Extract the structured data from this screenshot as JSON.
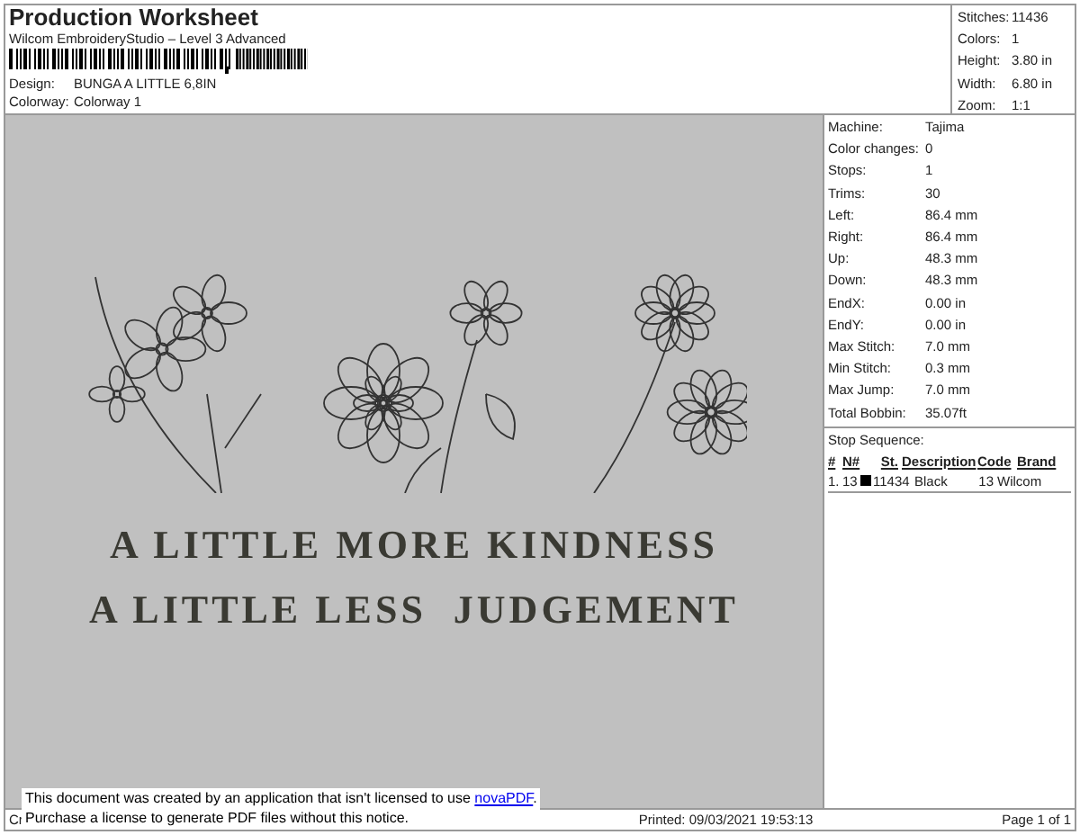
{
  "header": {
    "title": "Production Worksheet",
    "subtitle": "Wilcom EmbroideryStudio – Level 3 Advanced",
    "design": {
      "label": "Design:",
      "value": "BUNGA A LITTLE 6,8IN"
    },
    "colorway": {
      "label": "Colorway:",
      "value": "Colorway 1"
    }
  },
  "summary": [
    {
      "label": "Stitches:",
      "value": "11436"
    },
    {
      "label": "Colors:",
      "value": "1"
    },
    {
      "label": "Height:",
      "value": "3.80 in"
    },
    {
      "label": "Width:",
      "value": "6.80 in"
    },
    {
      "label": "Zoom:",
      "value": "1:1"
    }
  ],
  "design_preview": {
    "lines": [
      "A LITTLE MORE KINDNESS",
      "A LITTLE LESS  JUDGEMENT"
    ]
  },
  "details": [
    {
      "label": "Machine:",
      "value": "Tajima"
    },
    {
      "label": "Color changes:",
      "value": "0"
    },
    {
      "label": "Stops:",
      "value": "1"
    },
    {
      "label": "Trims:",
      "value": "30"
    },
    {
      "label": "Left:",
      "value": "86.4 mm"
    },
    {
      "label": "Right:",
      "value": "86.4 mm"
    },
    {
      "label": "Up:",
      "value": "48.3 mm"
    },
    {
      "label": "Down:",
      "value": "48.3 mm"
    },
    {
      "label": "EndX:",
      "value": "0.00 in"
    },
    {
      "label": "EndY:",
      "value": "0.00 in"
    },
    {
      "label": "Max Stitch:",
      "value": "7.0 mm"
    },
    {
      "label": "Min Stitch:",
      "value": "0.3 mm"
    },
    {
      "label": "Max Jump:",
      "value": "7.0 mm"
    },
    {
      "label": "Total Bobbin:",
      "value": "35.07ft"
    }
  ],
  "stop_sequence": {
    "title": "Stop Sequence:",
    "columns": [
      "#",
      "N#",
      "St.",
      "Description",
      "Code",
      "Brand"
    ],
    "rows": [
      {
        "index": "1.",
        "needle": "13",
        "color": "#000000",
        "stitches": "11434",
        "description": "Black",
        "code": "13",
        "brand": "Wilcom"
      }
    ]
  },
  "footer": {
    "left": "Cr",
    "printed": "Printed: 09/03/2021 19:53:13",
    "page": "Page 1 of 1"
  },
  "notice": {
    "line1": "This document was created by an application that isn't licensed to use ",
    "link": "novaPDF",
    "line1_end": ".",
    "line2": "Purchase a license to generate PDF files without this notice."
  }
}
